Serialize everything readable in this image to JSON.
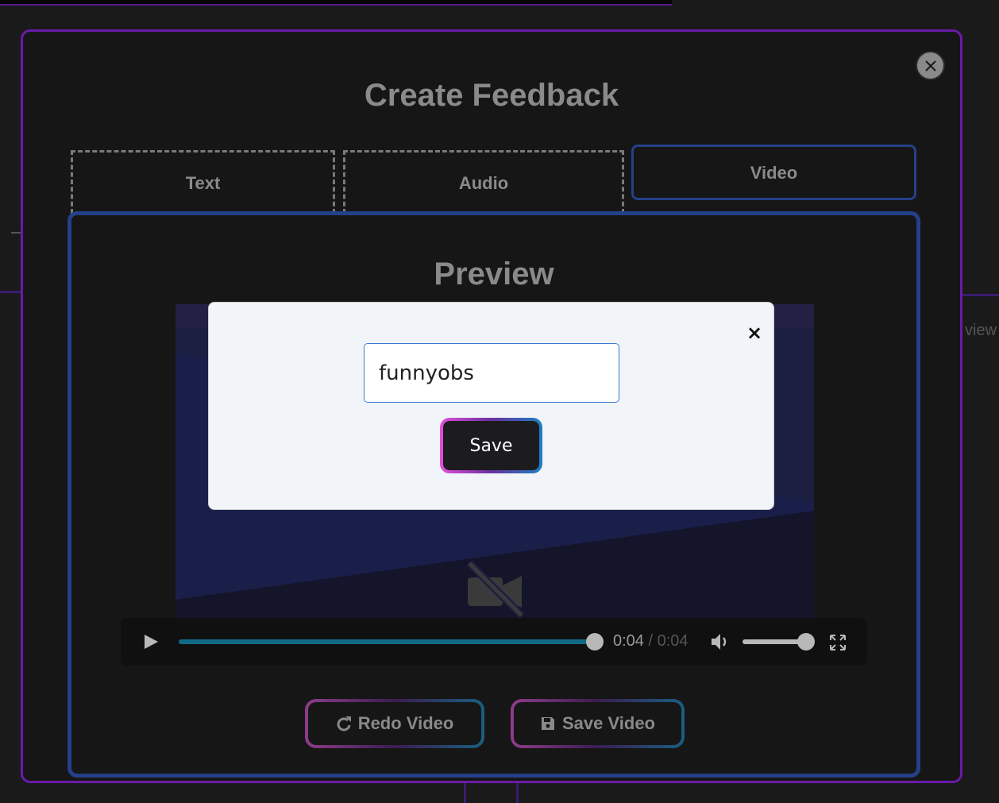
{
  "modal": {
    "title": "Create Feedback"
  },
  "tabs": [
    {
      "label": "Text"
    },
    {
      "label": "Audio"
    },
    {
      "label": "Video"
    }
  ],
  "panel": {
    "title": "Preview"
  },
  "player": {
    "current_time": "0:04",
    "separator": " / ",
    "duration": "0:04",
    "progress": 1.0,
    "volume": 1.0
  },
  "actions": {
    "redo_label": "Redo Video",
    "save_label": "Save Video"
  },
  "dialog": {
    "close_glyph": "×",
    "input_value": "funnyobs",
    "save_label": "Save"
  },
  "background": {
    "side_text": "view"
  },
  "colors": {
    "accent_purple": "#6a1aa8",
    "accent_blue": "#24408a",
    "progress": "#0f6a86"
  }
}
